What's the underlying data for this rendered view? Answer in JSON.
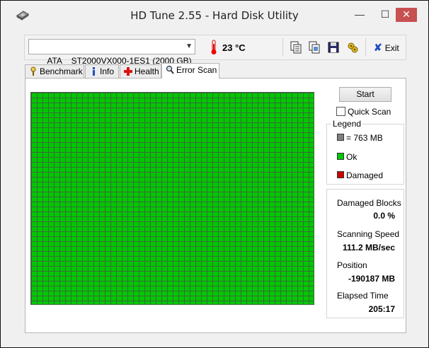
{
  "window": {
    "title": "HD Tune 2.55 - Hard Disk Utility"
  },
  "titlebar": {
    "minimize_label": "—",
    "maximize_label": "☐",
    "close_label": "✕"
  },
  "toolbar": {
    "drive_selected": "ATA    ST2000VX000-1ES1 (2000 GB)",
    "temperature": "23 °C",
    "exit_label": "Exit",
    "icons": [
      "copy-text-icon",
      "copy-screenshot-icon",
      "save-icon",
      "options-icon",
      "exit-icon"
    ]
  },
  "tabs": [
    {
      "label": "Benchmark",
      "icon": "benchmark-icon",
      "active": false
    },
    {
      "label": "Info",
      "icon": "info-icon",
      "active": false
    },
    {
      "label": "Health",
      "icon": "health-icon",
      "active": false
    },
    {
      "label": "Error Scan",
      "icon": "magnifier-icon",
      "active": true
    }
  ],
  "scan": {
    "start_label": "Start",
    "quick_scan_label": "Quick Scan",
    "quick_scan_checked": false,
    "block_color": "#00c800"
  },
  "legend": {
    "title": "Legend",
    "items": [
      {
        "label": "= 763 MB",
        "color": "#808080"
      },
      {
        "label": "Ok",
        "color": "#00c800"
      },
      {
        "label": "Damaged",
        "color": "#cc0000"
      }
    ]
  },
  "stats": {
    "damaged_blocks_label": "Damaged Blocks",
    "damaged_blocks_value": "0.0 %",
    "scanning_speed_label": "Scanning Speed",
    "scanning_speed_value": "111.2 MB/sec",
    "position_label": "Position",
    "position_value": "-190187 MB",
    "elapsed_label": "Elapsed Time",
    "elapsed_value": "205:17"
  }
}
